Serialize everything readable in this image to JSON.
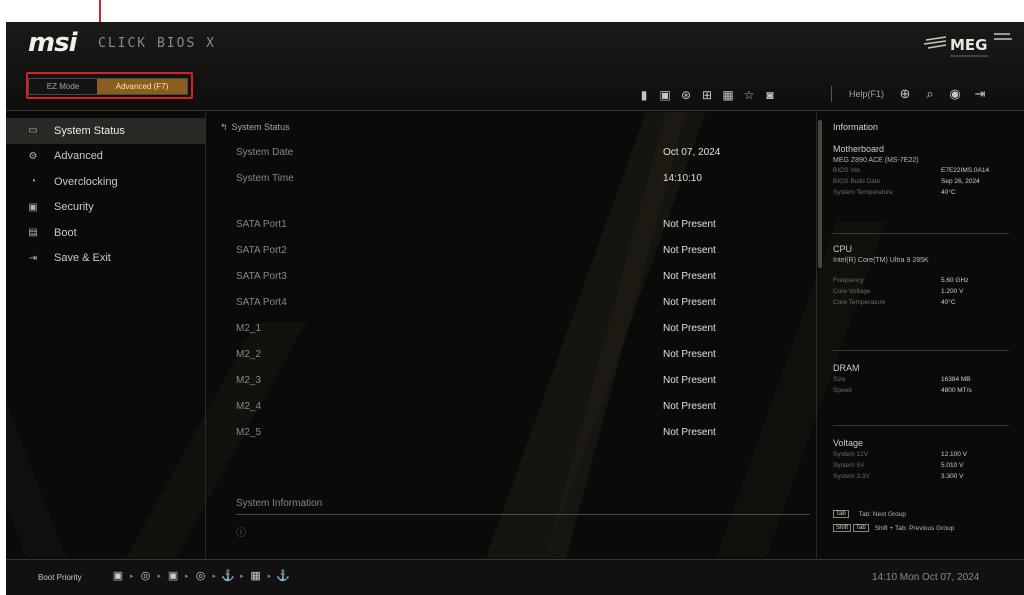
{
  "header": {
    "brand": "msi",
    "product": "CLICK BIOS X",
    "modes": {
      "ez": "EZ Mode",
      "advanced": "Advanced (F7)"
    },
    "toolbar_icons": [
      "usb-icon",
      "cpu-icon",
      "fan-icon",
      "monitor-icon",
      "memory-icon",
      "favorite-icon",
      "save-icon"
    ],
    "help": "Help(F1)",
    "right_icons": [
      "language-icon",
      "search-icon",
      "screenshot-icon",
      "exit-icon"
    ],
    "logo": "MEG"
  },
  "sidebar": {
    "items": [
      {
        "label": "System Status",
        "icon": "monitor-icon",
        "active": true
      },
      {
        "label": "Advanced",
        "icon": "gear-icon",
        "active": false
      },
      {
        "label": "Overclocking",
        "icon": "gauge-icon",
        "active": false
      },
      {
        "label": "Security",
        "icon": "lock-icon",
        "active": false
      },
      {
        "label": "Boot",
        "icon": "boot-icon",
        "active": false
      },
      {
        "label": "Save & Exit",
        "icon": "exit-icon",
        "active": false
      }
    ]
  },
  "main": {
    "breadcrumb": "System Status",
    "rows": [
      {
        "label": "System Date",
        "value": "Oct 07, 2024"
      },
      {
        "label": "System Time",
        "value": "14:10:10"
      },
      {
        "label": "SATA Port1",
        "value": "Not Present"
      },
      {
        "label": "SATA Port2",
        "value": "Not Present"
      },
      {
        "label": "SATA Port3",
        "value": "Not Present"
      },
      {
        "label": "SATA Port4",
        "value": "Not Present"
      },
      {
        "label": "M2_1",
        "value": "Not Present"
      },
      {
        "label": "M2_2",
        "value": "Not Present"
      },
      {
        "label": "M2_3",
        "value": "Not Present"
      },
      {
        "label": "M2_4",
        "value": "Not Present"
      },
      {
        "label": "M2_5",
        "value": "Not Present"
      }
    ],
    "section_title": "System Information",
    "section_marker": "ⓘ"
  },
  "info": {
    "title": "Information",
    "motherboard": {
      "head": "Motherboard",
      "model": "MEG Z890 ACE (MS-7E22)",
      "items": [
        {
          "k": "BIOS Ver.",
          "v": "E7E22IMS.0A14"
        },
        {
          "k": "BIOS Build Date",
          "v": "Sep 26, 2024"
        },
        {
          "k": "System Temperature",
          "v": "40°C"
        }
      ]
    },
    "cpu": {
      "head": "CPU",
      "model": "Intel(R) Core(TM) Ultra 9 285K",
      "items": [
        {
          "k": "Frequency",
          "v": "5.60 GHz"
        },
        {
          "k": "Core Voltage",
          "v": "1.200 V"
        },
        {
          "k": "Core Temperature",
          "v": "40°C"
        }
      ]
    },
    "dram": {
      "head": "DRAM",
      "items": [
        {
          "k": "Size",
          "v": "16384 MB"
        },
        {
          "k": "Speed",
          "v": "4800 MT/s"
        }
      ]
    },
    "voltage": {
      "head": "Voltage",
      "items": [
        {
          "k": "System 12V",
          "v": "12.100 V"
        },
        {
          "k": "System 5V",
          "v": "5.010 V"
        },
        {
          "k": "System 3.3V",
          "v": "3.300 V"
        }
      ]
    },
    "hints": [
      {
        "keys": [
          "Tab"
        ],
        "text": "Tab: Next Group"
      },
      {
        "keys": [
          "Shift",
          "Tab"
        ],
        "text": "Shift + Tab: Previous Group"
      }
    ]
  },
  "footer": {
    "boot_label": "Boot Priority",
    "boot_devices": [
      "hdd-icon",
      "optical-disc-icon",
      "hdd-icon",
      "optical-disc-icon",
      "usb-icon",
      "network-icon",
      "usb-icon"
    ],
    "clock": "14:10  Mon Oct 07, 2024"
  },
  "colors": {
    "accent": "#8a5e1f",
    "callout": "#d2232a",
    "background": "#0b0a09"
  }
}
